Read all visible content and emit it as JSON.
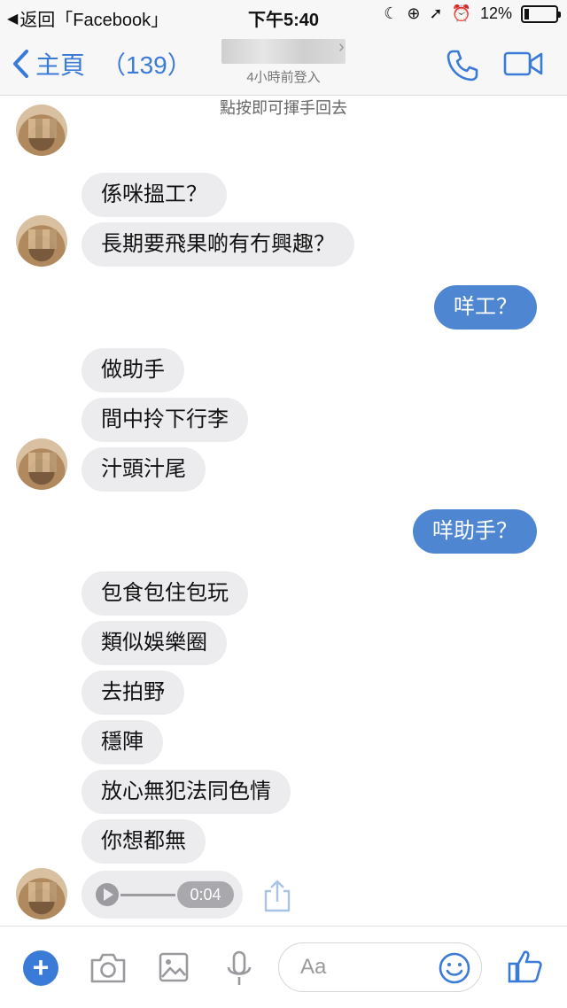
{
  "status_bar": {
    "back_label": "返回「Facebook」",
    "time": "下午5:40",
    "battery": "12%"
  },
  "nav": {
    "back_label": "主頁",
    "unread_count": "（139）",
    "last_seen": "4小時前登入"
  },
  "chat": {
    "hint": "點按即可揮手回去",
    "messages": [
      {
        "text": "係咪搵工？",
        "from": "them"
      },
      {
        "text": "長期要飛果啲有冇興趣？",
        "from": "them"
      },
      {
        "text": "咩工？",
        "from": "me"
      },
      {
        "text": "做助手",
        "from": "them"
      },
      {
        "text": "間中拎下行李",
        "from": "them"
      },
      {
        "text": "汁頭汁尾",
        "from": "them"
      },
      {
        "text": "咩助手？",
        "from": "me"
      },
      {
        "text": "包食包住包玩",
        "from": "them"
      },
      {
        "text": "類似娛樂圈",
        "from": "them"
      },
      {
        "text": "去拍野",
        "from": "them"
      },
      {
        "text": "穩陣",
        "from": "them"
      },
      {
        "text": "放心無犯法同色情",
        "from": "them"
      },
      {
        "text": "你想都無",
        "from": "them"
      }
    ],
    "audio": {
      "duration": "0:04"
    }
  },
  "composer": {
    "placeholder": "Aa"
  },
  "colors": {
    "accent": "#3b7bd8",
    "outgoing_bubble": "#4f86d1",
    "incoming_bubble": "#ececef"
  },
  "icons": [
    "chevron-left-icon",
    "phone-icon",
    "video-camera-icon",
    "play-icon",
    "share-icon",
    "plus-icon",
    "camera-icon",
    "image-icon",
    "microphone-icon",
    "emoji-icon",
    "thumbs-up-icon"
  ]
}
